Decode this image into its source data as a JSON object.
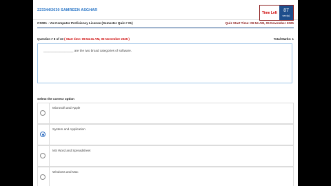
{
  "header": {
    "student": "223344/2630 SAMREEN ASGHAR",
    "time_left_label": "Time Left",
    "time_left_value": "87",
    "time_left_unit": "sec(s)"
  },
  "course": {
    "title": "CS001 - VU-Computer Proficiency License (Semester Quiz # 01)",
    "quiz_start": "Quiz Start Time: 09:54 AM, 05 November 2025"
  },
  "question": {
    "number": "Question # 8 of 10",
    "start_time": "( Start time: 09:54:31 AM, 05 November 2025 )",
    "total_marks": "Total Marks: 1",
    "text": "_________________ are the two broad categories of software."
  },
  "select_label": "Select the correct option",
  "options": [
    {
      "label": "Microsoft and Apple",
      "checked": false
    },
    {
      "label": "System and Application",
      "checked": true
    },
    {
      "label": "MS Word and Spreadsheet",
      "checked": false
    },
    {
      "label": "Windows and Mac",
      "checked": false
    }
  ],
  "colors": {
    "accent_blue": "#1e4e8c",
    "student_blue": "#1f6fc4",
    "alert_red": "#c00000"
  }
}
